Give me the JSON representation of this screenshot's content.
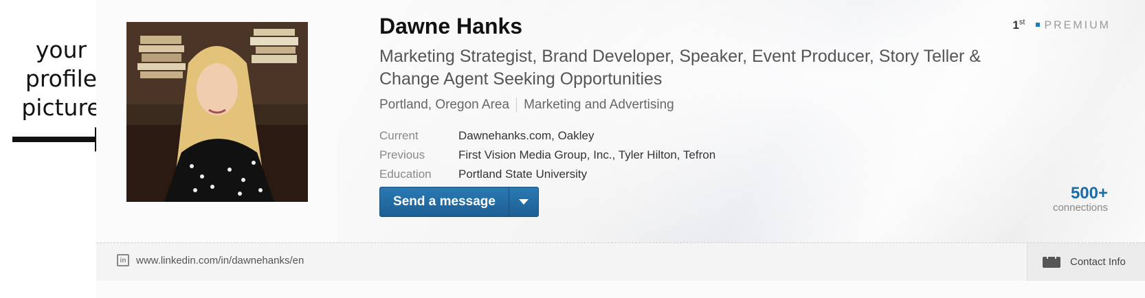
{
  "annotation": {
    "line1": "your",
    "line2": "profile",
    "line3": "picture"
  },
  "profile": {
    "name": "Dawne Hanks",
    "headline": "Marketing Strategist, Brand Developer, Speaker, Event Producer, Story Teller & Change Agent Seeking Opportunities",
    "location": "Portland, Oregon Area",
    "industry": "Marketing and Advertising",
    "details": [
      {
        "label": "Current",
        "value": "Dawnehanks.com, Oakley"
      },
      {
        "label": "Previous",
        "value": "First Vision Media Group, Inc., Tyler Hilton, Tefron"
      },
      {
        "label": "Education",
        "value": "Portland State University"
      }
    ],
    "degree": "1",
    "degree_suffix": "st",
    "premium": "PREMIUM",
    "connections_count": "500+",
    "connections_label": "connections"
  },
  "actions": {
    "send_message": "Send a message"
  },
  "footer": {
    "url": "www.linkedin.com/in/dawnehanks/en",
    "contact_info": "Contact Info"
  },
  "colors": {
    "button": "#1d6aa5",
    "accent": "#1a6ba6"
  }
}
